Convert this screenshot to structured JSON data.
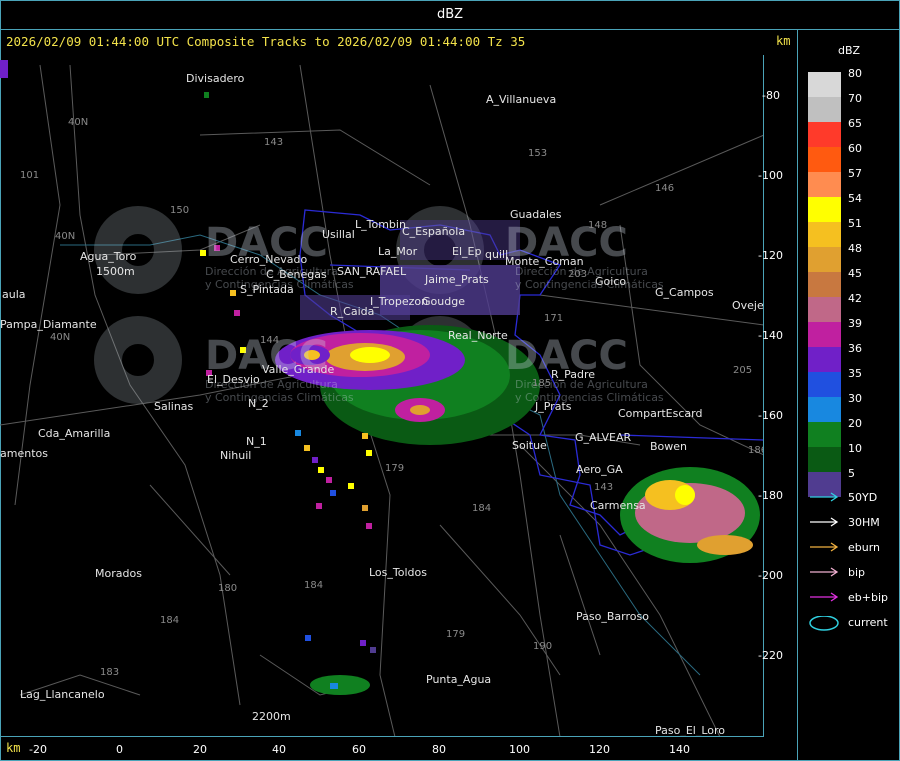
{
  "window": {
    "title": "dBZ"
  },
  "header": {
    "text": "2026/02/09 01:44:00 UTC Composite Tracks to 2026/02/09 01:44:00 Tz 35",
    "km_top": "km",
    "km_bottom": "km"
  },
  "legend": {
    "title": "dBZ",
    "scale": [
      {
        "label": "80",
        "color": "#d8d8d8"
      },
      {
        "label": "70",
        "color": "#c0c0c0"
      },
      {
        "label": "65",
        "color": "#ff3a2a"
      },
      {
        "label": "60",
        "color": "#ff5a10"
      },
      {
        "label": "57",
        "color": "#ff8c50"
      },
      {
        "label": "54",
        "color": "#ffff00"
      },
      {
        "label": "51",
        "color": "#f5c020"
      },
      {
        "label": "48",
        "color": "#e0a030"
      },
      {
        "label": "45",
        "color": "#c87840"
      },
      {
        "label": "42",
        "color": "#c06888"
      },
      {
        "label": "39",
        "color": "#c020a0"
      },
      {
        "label": "36",
        "color": "#7020c8"
      },
      {
        "label": "35",
        "color": "#2050e0"
      },
      {
        "label": "30",
        "color": "#1888e0"
      },
      {
        "label": "20",
        "color": "#108020"
      },
      {
        "label": "10",
        "color": "#0a5a14"
      },
      {
        "label": "5",
        "color": "#503c90"
      }
    ],
    "tracks": [
      {
        "label": "50YD",
        "color": "#30d0e0"
      },
      {
        "label": "30HM",
        "color": "#ffffff"
      },
      {
        "label": "eburn",
        "color": "#f0b040"
      },
      {
        "label": "bip",
        "color": "#f0b0d0"
      },
      {
        "label": "eb+bip",
        "color": "#e030e0"
      },
      {
        "label": "current",
        "color": "#30d0e0"
      }
    ]
  },
  "axes": {
    "y_ticks": [
      "-80",
      "-100",
      "-120",
      "-140",
      "-160",
      "-180",
      "-200",
      "-220"
    ],
    "x_ticks": [
      "-20",
      "0",
      "20",
      "40",
      "60",
      "80",
      "100",
      "120",
      "140"
    ]
  },
  "places": [
    {
      "name": "Divisadero"
    },
    {
      "name": "A_Villanueva"
    },
    {
      "name": "Guadales"
    },
    {
      "name": "Usillal"
    },
    {
      "name": "L_Tombin"
    },
    {
      "name": "C_Española"
    },
    {
      "name": "La_Mor"
    },
    {
      "name": "El_Ep"
    },
    {
      "name": "quill"
    },
    {
      "name": "Agua_Toro"
    },
    {
      "name": "1500m"
    },
    {
      "name": "Cerro_Nevado"
    },
    {
      "name": "C_Benegas"
    },
    {
      "name": "SAN_RAFAEL"
    },
    {
      "name": "Jaime_Prats"
    },
    {
      "name": "S_Pintada"
    },
    {
      "name": "I_Tropezon"
    },
    {
      "name": "Goudge"
    },
    {
      "name": "aula"
    },
    {
      "name": "Pampa_Diamante"
    },
    {
      "name": "R_Caida"
    },
    {
      "name": "Monte_Coman"
    },
    {
      "name": "Goico"
    },
    {
      "name": "G_Campos"
    },
    {
      "name": "Oveje"
    },
    {
      "name": "Real_Norte"
    },
    {
      "name": "Valle_Grande"
    },
    {
      "name": "El_Desvio"
    },
    {
      "name": "Salinas"
    },
    {
      "name": "R_Padre"
    },
    {
      "name": "J_Prats"
    },
    {
      "name": "CompartEscard"
    },
    {
      "name": "Cda_Amarilla"
    },
    {
      "name": "Soitue"
    },
    {
      "name": "G_ALVEAR"
    },
    {
      "name": "Bowen"
    },
    {
      "name": "amentos"
    },
    {
      "name": "Nihuil"
    },
    {
      "name": "N_1"
    },
    {
      "name": "N_2"
    },
    {
      "name": "Aero_GA"
    },
    {
      "name": "Carmensa"
    },
    {
      "name": "Morados"
    },
    {
      "name": "Los_Toldos"
    },
    {
      "name": "Paso_Barroso"
    },
    {
      "name": "Lag_Llancanelo"
    },
    {
      "name": "Punta_Agua"
    },
    {
      "name": "2200m"
    },
    {
      "name": "Paso_El_Loro"
    }
  ],
  "roads": [
    "101",
    "40N",
    "143",
    "153",
    "150",
    "146",
    "40N",
    "148",
    "203",
    "171",
    "144",
    "40N",
    "185",
    "205",
    "179",
    "184",
    "180",
    "184",
    "179",
    "190",
    "184",
    "183",
    "143",
    "186"
  ],
  "watermark": {
    "brand": "DACC",
    "line1": "Dirección de Agricultura",
    "line2": "y Contingencias Climáticas"
  }
}
